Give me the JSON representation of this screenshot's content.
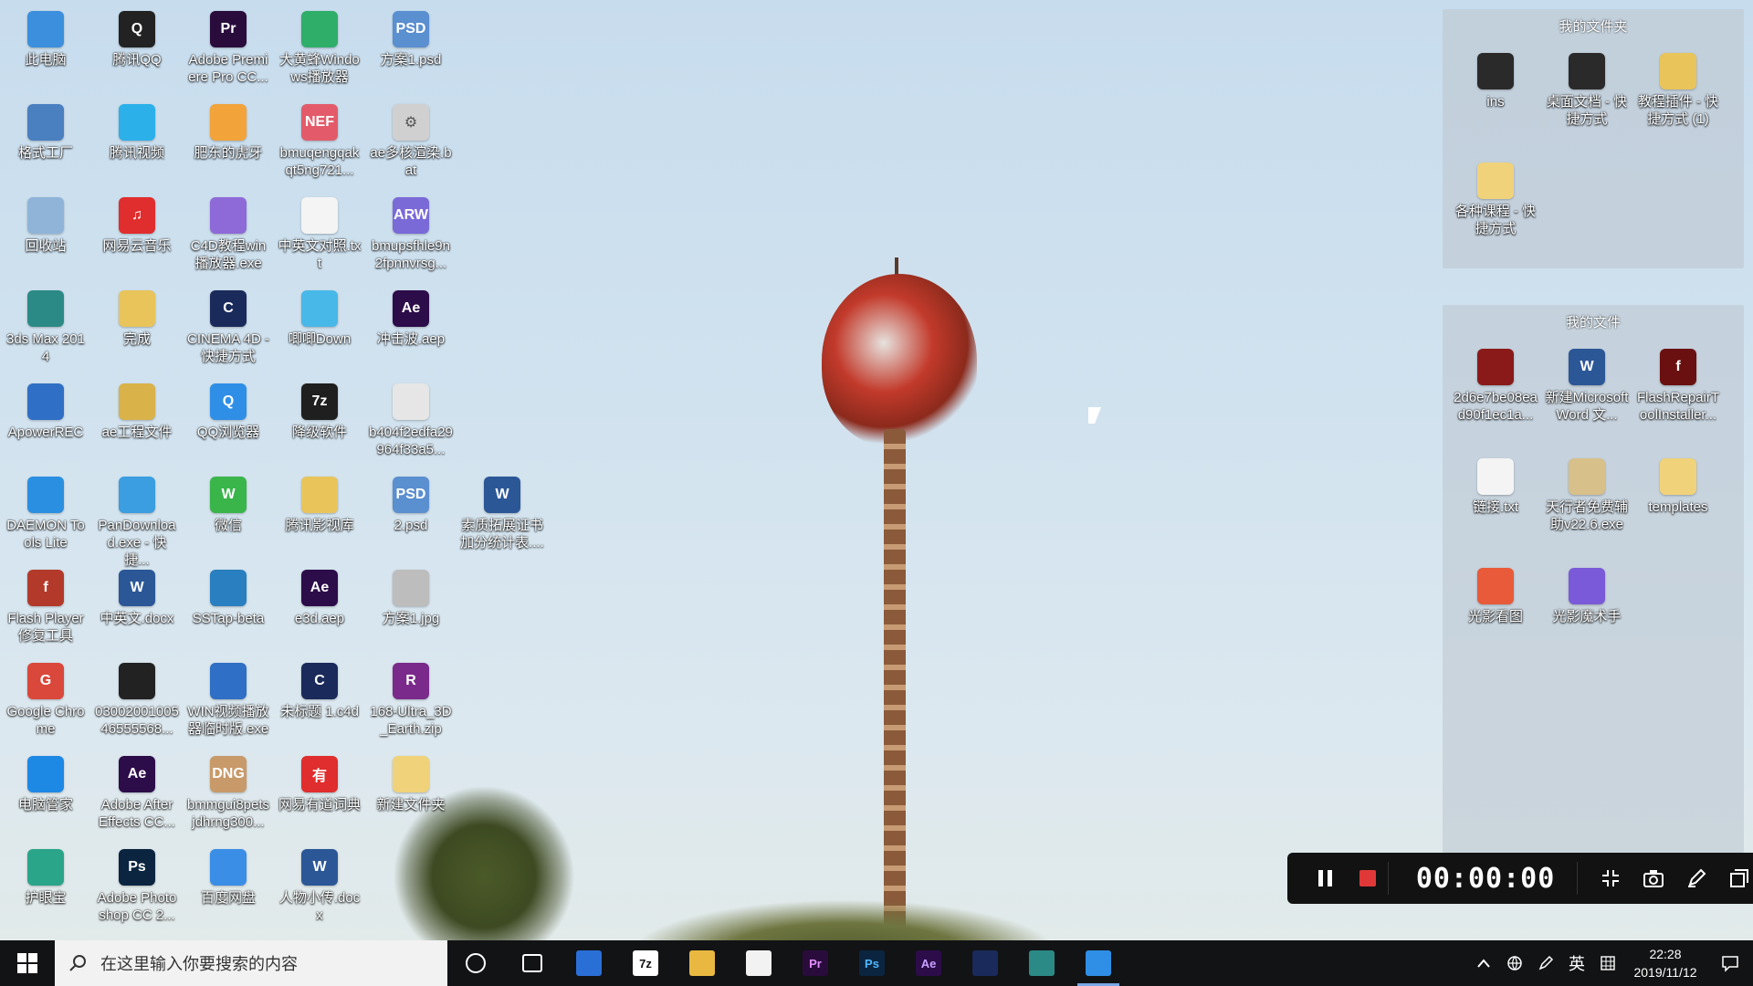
{
  "desktop": {
    "icons": [
      {
        "label": "此电脑",
        "icon": "computer-icon",
        "color": "#3b8fdc"
      },
      {
        "label": "格式工厂",
        "icon": "format-factory-icon",
        "color": "#4a7fc0"
      },
      {
        "label": "回收站",
        "icon": "recycle-bin-icon",
        "color": "#8fb4d8"
      },
      {
        "label": "3ds Max 2014",
        "icon": "3dsmax-icon",
        "color": "#2b8a86"
      },
      {
        "label": "ApowerREC",
        "icon": "apowerrec-icon",
        "color": "#2f6fc5"
      },
      {
        "label": "DAEMON Tools Lite",
        "icon": "daemon-tools-icon",
        "color": "#2a8fe0"
      },
      {
        "label": "Flash Player 修复工具",
        "icon": "flash-repair-icon",
        "color": "#b33a2a"
      },
      {
        "label": "Google Chrome",
        "icon": "chrome-icon",
        "color": "#d9483b"
      },
      {
        "label": "电脑管家",
        "icon": "pc-manager-icon",
        "color": "#1e88e5"
      },
      {
        "label": "护眼宝",
        "icon": "eye-care-icon",
        "color": "#2ba58a"
      },
      {
        "label": "腾讯QQ",
        "icon": "qq-icon",
        "color": "#222222"
      },
      {
        "label": "腾讯视频",
        "icon": "tencent-video-icon",
        "color": "#2bb0ea"
      },
      {
        "label": "网易云音乐",
        "icon": "netease-music-icon",
        "color": "#e02d2d"
      },
      {
        "label": "完成",
        "icon": "folder-icon",
        "color": "#e8c45a"
      },
      {
        "label": "ae工程文件",
        "icon": "folder-icon",
        "color": "#d9b24a"
      },
      {
        "label": "PanDownload.exe - 快捷...",
        "icon": "pandownload-icon",
        "color": "#3a9ee0"
      },
      {
        "label": "中英文.docx",
        "icon": "word-doc-icon",
        "color": "#2b5797"
      },
      {
        "label": "0300200100546555568...",
        "icon": "image-file-icon",
        "color": "#222222"
      },
      {
        "label": "Adobe After Effects CC...",
        "icon": "after-effects-icon",
        "color": "#2d0c4a"
      },
      {
        "label": "Adobe Photoshop CC 2...",
        "icon": "photoshop-icon",
        "color": "#0b2540"
      },
      {
        "label": "Adobe Premiere Pro CC...",
        "icon": "premiere-icon",
        "color": "#2a0c3c"
      },
      {
        "label": "肥东的虎牙",
        "icon": "huya-icon",
        "color": "#f2a33a"
      },
      {
        "label": "C4D教程win播放器.exe",
        "icon": "c4d-player-icon",
        "color": "#8e6ad8"
      },
      {
        "label": "CINEMA 4D - 快捷方式",
        "icon": "cinema4d-icon",
        "color": "#1a2a5a"
      },
      {
        "label": "QQ浏览器",
        "icon": "qq-browser-icon",
        "color": "#2f8fe6"
      },
      {
        "label": "微信",
        "icon": "wechat-icon",
        "color": "#39b54a"
      },
      {
        "label": "SSTap-beta",
        "icon": "sstap-icon",
        "color": "#2a7fc0"
      },
      {
        "label": "WIN视频播放器临时版.exe",
        "icon": "video-player-icon",
        "color": "#2f6fc5"
      },
      {
        "label": "bmmgui8petsjdhrng300...",
        "icon": "dng-file-icon",
        "color": "#c89a6a"
      },
      {
        "label": "百度网盘",
        "icon": "baidu-netdisk-icon",
        "color": "#3a8ee6"
      },
      {
        "label": "大黄蜂Windows播放器",
        "icon": "player-icon",
        "color": "#2fae6a"
      },
      {
        "label": "bmuqengqakqt5ng721...",
        "icon": "nef-file-icon",
        "color": "#e35b6a"
      },
      {
        "label": "中英文对照.txt",
        "icon": "text-file-icon",
        "color": "#f4f4f4"
      },
      {
        "label": "唧唧Down",
        "icon": "jijidown-icon",
        "color": "#48b8e8"
      },
      {
        "label": "降级软件",
        "icon": "7zip-icon",
        "color": "#1f1f1f"
      },
      {
        "label": "腾讯影视库",
        "icon": "folder-icon",
        "color": "#e8c45a"
      },
      {
        "label": "e3d.aep",
        "icon": "aep-file-icon",
        "color": "#2d0c4a"
      },
      {
        "label": "未标题 1.c4d",
        "icon": "c4d-file-icon",
        "color": "#1a2a5a"
      },
      {
        "label": "网易有道词典",
        "icon": "youdao-icon",
        "color": "#e02d2d"
      },
      {
        "label": "人物小传.docx",
        "icon": "word-doc-icon",
        "color": "#2b5797"
      },
      {
        "label": "方案1.psd",
        "icon": "psd-file-icon",
        "color": "#5a8fd0"
      },
      {
        "label": "ae多核渲染.bat",
        "icon": "bat-file-icon",
        "color": "#d0d0d0"
      },
      {
        "label": "bmupsfhle9n2fpnnvrsg...",
        "icon": "arw-file-icon",
        "color": "#7a6ad8"
      },
      {
        "label": "冲击波.aep",
        "icon": "aep-file-icon",
        "color": "#2d0c4a"
      },
      {
        "label": "b404f2edfa29964f33a5...",
        "icon": "image-file-icon",
        "color": "#e6e6e6"
      },
      {
        "label": "2.psd",
        "icon": "psd-file-icon",
        "color": "#5a8fd0"
      },
      {
        "label": "方案1.jpg",
        "icon": "image-file-icon",
        "color": "#bdbdbd"
      },
      {
        "label": "168-Ultra_3D_Earth.zip",
        "icon": "winrar-icon",
        "color": "#7a2a8a"
      },
      {
        "label": "新建文件夹",
        "icon": "folder-icon",
        "color": "#f0d27a"
      },
      {
        "label": "素质拓展证书加分统计表....",
        "icon": "word-doc-icon",
        "color": "#2b5797"
      }
    ]
  },
  "fences": [
    {
      "title": "我的文件夹",
      "items": [
        {
          "label": "ins",
          "icon": "folder-icon",
          "color": "#2a2a2a"
        },
        {
          "label": "桌面文档 - 快捷方式",
          "icon": "folder-icon",
          "color": "#2a2a2a"
        },
        {
          "label": "教程插件 - 快捷方式 (1)",
          "icon": "folder-icon",
          "color": "#e8c45a"
        },
        {
          "label": "各种课程 - 快捷方式",
          "icon": "folder-icon",
          "color": "#f0d27a"
        }
      ]
    },
    {
      "title": "我的文件",
      "items": [
        {
          "label": "2d6e7be08ead90f1ec1a...",
          "icon": "image-file-icon",
          "color": "#8a1a1a"
        },
        {
          "label": "新建Microsoft Word 文...",
          "icon": "word-doc-icon",
          "color": "#2b5797"
        },
        {
          "label": "FlashRepairToolInstaller...",
          "icon": "flash-repair-icon",
          "color": "#6a1010"
        },
        {
          "label": "链接.txt",
          "icon": "text-file-icon",
          "color": "#f4f4f4"
        },
        {
          "label": "天行者免费辅助v22.6.exe",
          "icon": "owl-app-icon",
          "color": "#d8c08a"
        },
        {
          "label": "templates",
          "icon": "folder-icon",
          "color": "#f0d27a"
        },
        {
          "label": "光影看图",
          "icon": "photo-viewer-icon",
          "color": "#e85a3a"
        },
        {
          "label": "光影魔术手",
          "icon": "photo-editor-icon",
          "color": "#7a5ad8"
        }
      ]
    }
  ],
  "recorder": {
    "timer": "00:00:00",
    "buttons": [
      "pause",
      "stop",
      "fullscreen",
      "screenshot",
      "annotate",
      "window"
    ]
  },
  "taskbar": {
    "search_placeholder": "在这里输入你要搜索的内容",
    "apps": [
      {
        "name": "cortana-icon",
        "label": ""
      },
      {
        "name": "task-view-icon",
        "label": ""
      },
      {
        "name": "security-icon",
        "label": ""
      },
      {
        "name": "7zip-icon",
        "label": "7z"
      },
      {
        "name": "file-explorer-icon",
        "label": ""
      },
      {
        "name": "notepad-icon",
        "label": ""
      },
      {
        "name": "premiere-icon",
        "label": "Pr"
      },
      {
        "name": "photoshop-icon",
        "label": "Ps"
      },
      {
        "name": "after-effects-icon",
        "label": "Ae"
      },
      {
        "name": "cinema4d-icon",
        "label": ""
      },
      {
        "name": "3dsmax-icon",
        "label": ""
      },
      {
        "name": "qq-browser-icon",
        "label": ""
      }
    ],
    "tray": {
      "ime": "英",
      "time": "22:28",
      "date": "2019/11/12"
    }
  }
}
